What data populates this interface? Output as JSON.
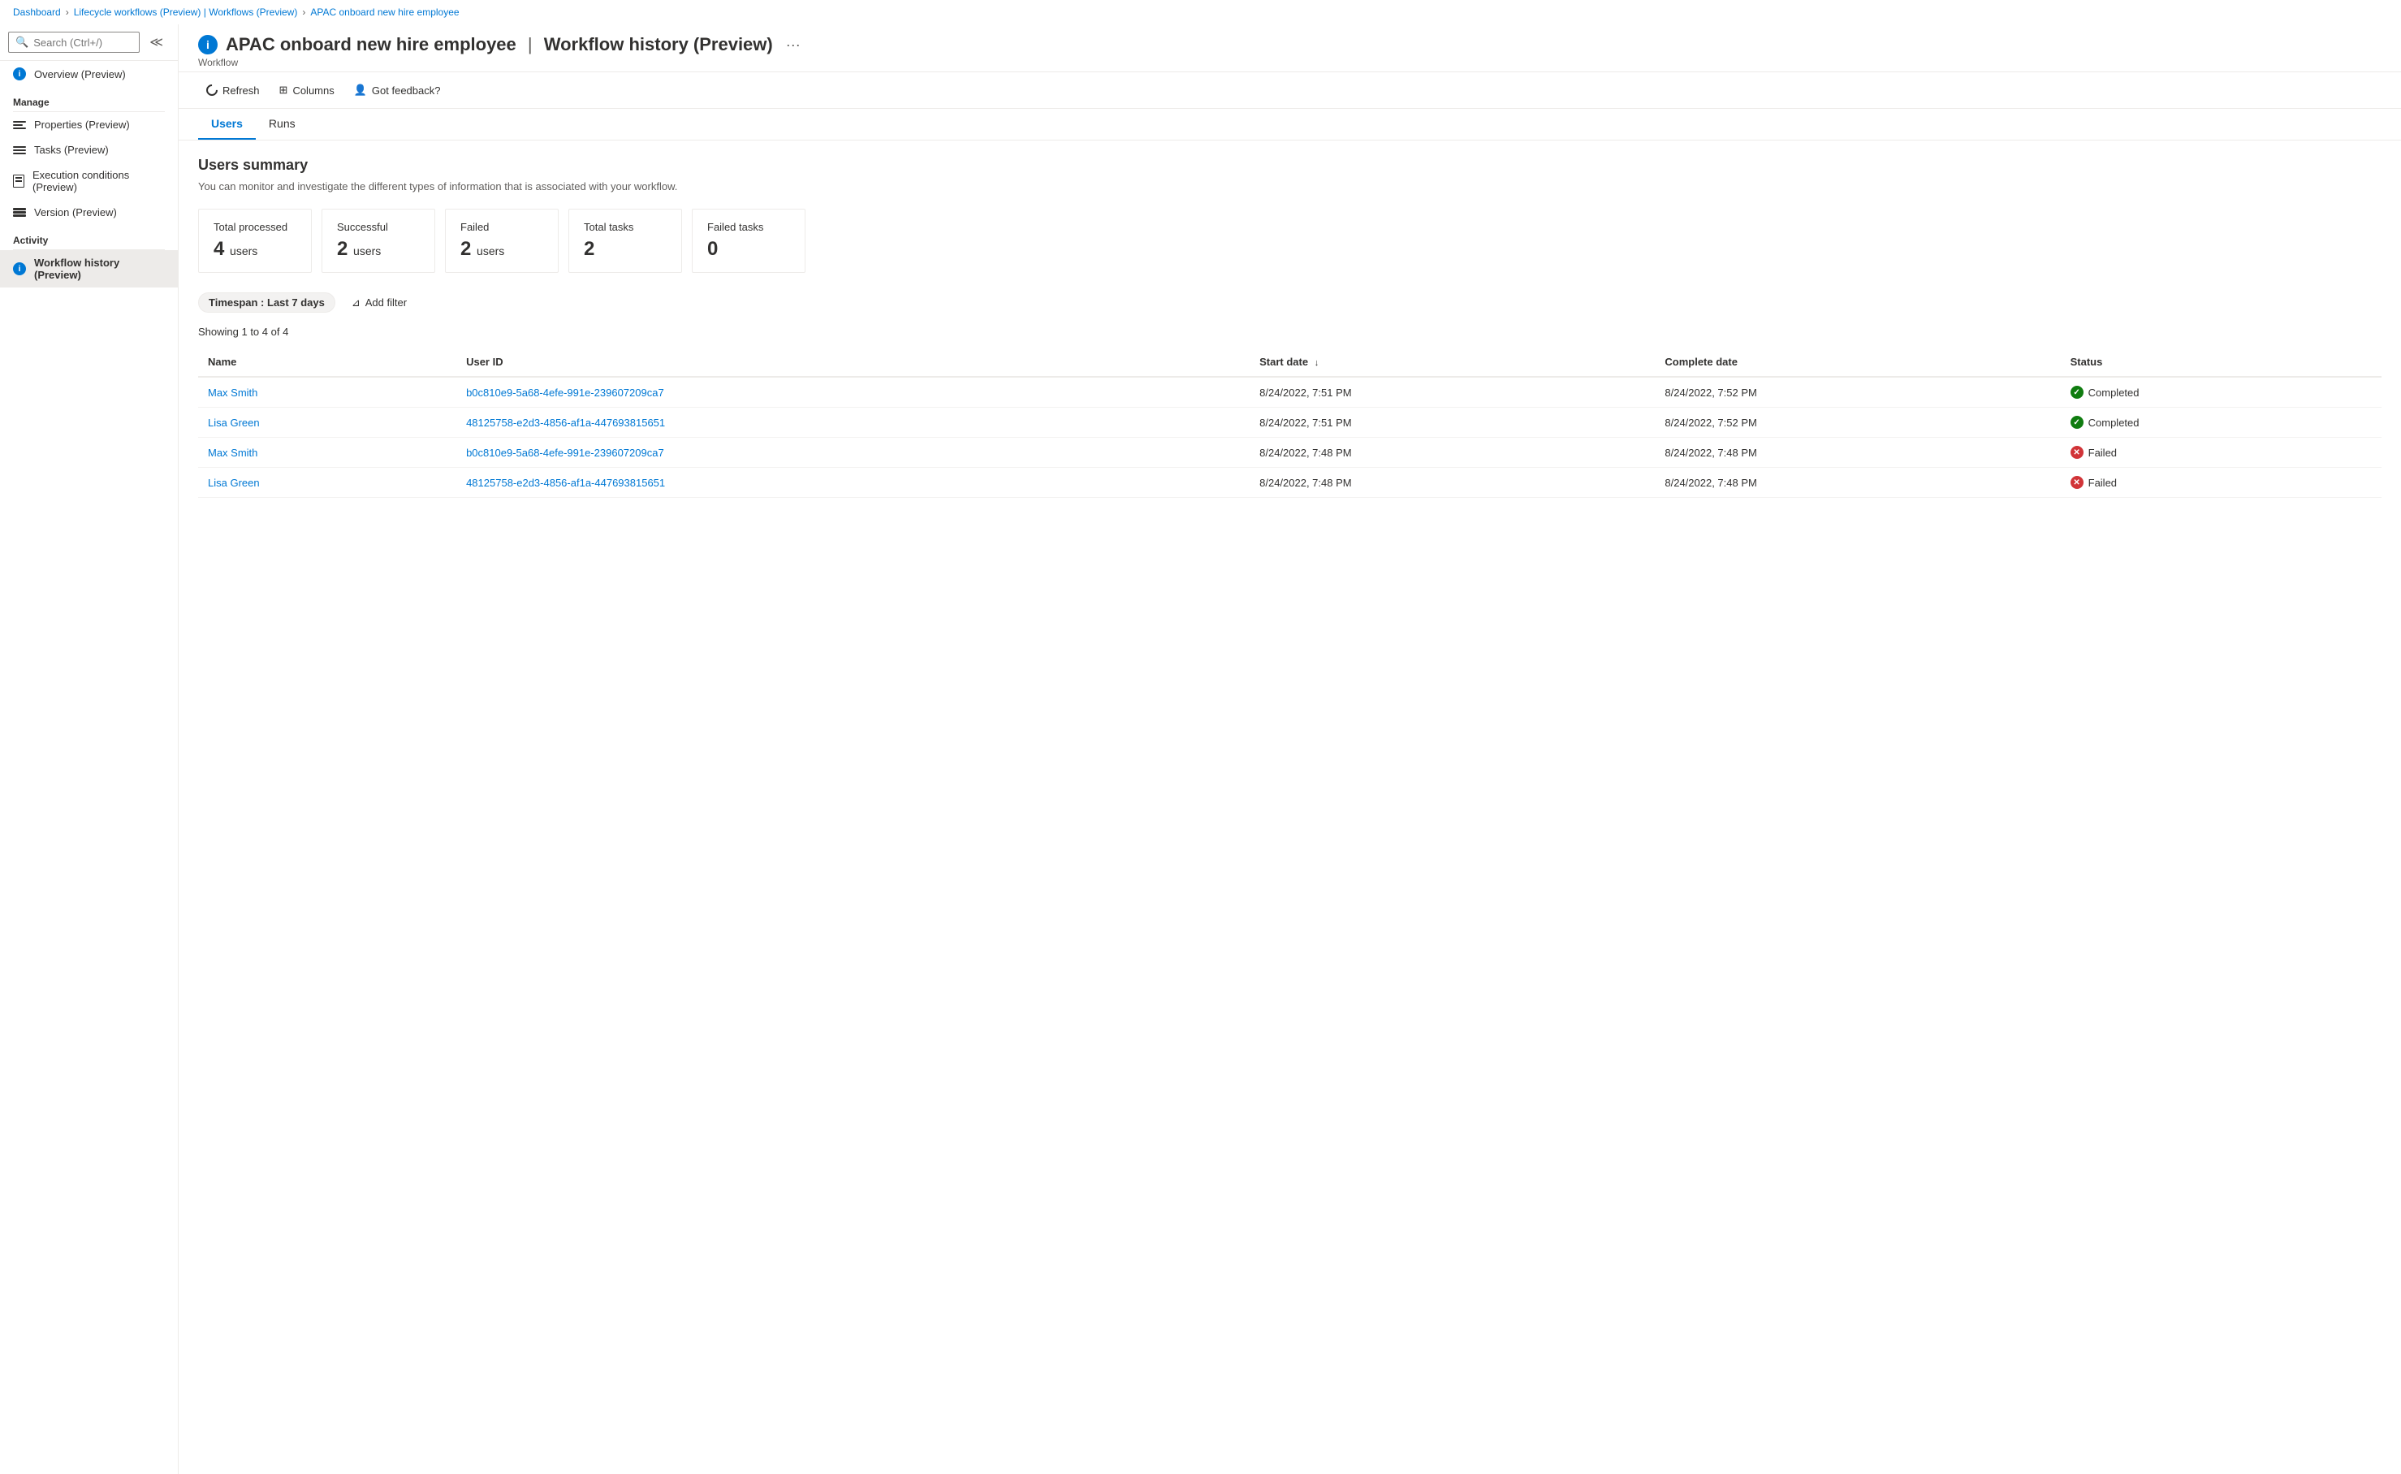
{
  "breadcrumb": {
    "items": [
      {
        "label": "Dashboard",
        "link": true
      },
      {
        "label": "Lifecycle workflows (Preview) | Workflows (Preview)",
        "link": true
      },
      {
        "label": "APAC onboard new hire employee",
        "link": true
      }
    ]
  },
  "page": {
    "title": "APAC onboard new hire employee",
    "subtitle_separator": "|",
    "subtitle_right": "Workflow history (Preview)",
    "subtitle_label": "Workflow",
    "more_icon": "···"
  },
  "toolbar": {
    "refresh_label": "Refresh",
    "columns_label": "Columns",
    "feedback_label": "Got feedback?"
  },
  "tabs": [
    {
      "label": "Users",
      "active": true
    },
    {
      "label": "Runs",
      "active": false
    }
  ],
  "users_summary": {
    "title": "Users summary",
    "description": "You can monitor and investigate the different types of information that is associated with your workflow.",
    "cards": [
      {
        "label": "Total processed",
        "value": "4",
        "unit": "users"
      },
      {
        "label": "Successful",
        "value": "2",
        "unit": "users"
      },
      {
        "label": "Failed",
        "value": "2",
        "unit": "users"
      },
      {
        "label": "Total tasks",
        "value": "2",
        "unit": ""
      },
      {
        "label": "Failed tasks",
        "value": "0",
        "unit": ""
      }
    ]
  },
  "filter": {
    "timespan_label": "Timespan : ",
    "timespan_value": "Last 7 days",
    "add_filter_label": "Add filter"
  },
  "showing_text": "Showing 1 to 4 of 4",
  "table": {
    "columns": [
      {
        "label": "Name",
        "sortable": false
      },
      {
        "label": "User ID",
        "sortable": false
      },
      {
        "label": "Start date",
        "sortable": true,
        "sort_dir": "↓"
      },
      {
        "label": "Complete date",
        "sortable": false
      },
      {
        "label": "Status",
        "sortable": false
      }
    ],
    "rows": [
      {
        "name": "Max Smith",
        "user_id": "b0c810e9-5a68-4efe-991e-239607209ca7",
        "start_date": "8/24/2022, 7:51 PM",
        "complete_date": "8/24/2022, 7:52 PM",
        "status": "Completed",
        "status_type": "completed"
      },
      {
        "name": "Lisa Green",
        "user_id": "48125758-e2d3-4856-af1a-447693815651",
        "start_date": "8/24/2022, 7:51 PM",
        "complete_date": "8/24/2022, 7:52 PM",
        "status": "Completed",
        "status_type": "completed"
      },
      {
        "name": "Max Smith",
        "user_id": "b0c810e9-5a68-4efe-991e-239607209ca7",
        "start_date": "8/24/2022, 7:48 PM",
        "complete_date": "8/24/2022, 7:48 PM",
        "status": "Failed",
        "status_type": "failed"
      },
      {
        "name": "Lisa Green",
        "user_id": "48125758-e2d3-4856-af1a-447693815651",
        "start_date": "8/24/2022, 7:48 PM",
        "complete_date": "8/24/2022, 7:48 PM",
        "status": "Failed",
        "status_type": "failed"
      }
    ]
  },
  "sidebar": {
    "search_placeholder": "Search (Ctrl+/)",
    "overview_label": "Overview (Preview)",
    "manage_label": "Manage",
    "manage_items": [
      {
        "label": "Properties (Preview)",
        "icon": "bars"
      },
      {
        "label": "Tasks (Preview)",
        "icon": "list"
      },
      {
        "label": "Execution conditions (Preview)",
        "icon": "doc"
      },
      {
        "label": "Version (Preview)",
        "icon": "stack"
      }
    ],
    "activity_label": "Activity",
    "activity_items": [
      {
        "label": "Workflow history (Preview)",
        "icon": "info",
        "active": true
      }
    ]
  }
}
